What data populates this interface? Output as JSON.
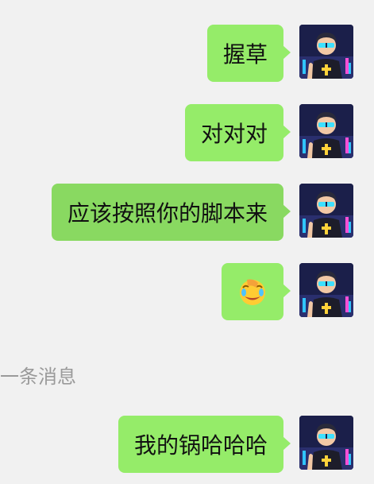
{
  "messages": [
    {
      "text": "握草",
      "type": "text"
    },
    {
      "text": "对对对",
      "type": "text"
    },
    {
      "text": "应该按照你的脚本来",
      "type": "text"
    },
    {
      "text": "",
      "type": "emoji",
      "emoji": "facepalm-laughing-emoji"
    },
    {
      "text": "我的锅哈哈哈",
      "type": "text"
    }
  ],
  "divider": {
    "text": "一条消息"
  },
  "colors": {
    "background": "#f1f1f1",
    "bubble": "#95ec69",
    "bubble_active": "#89d961",
    "divider_text": "#9a9a9a"
  },
  "avatar": {
    "icon": "cyber-priest-avatar"
  }
}
